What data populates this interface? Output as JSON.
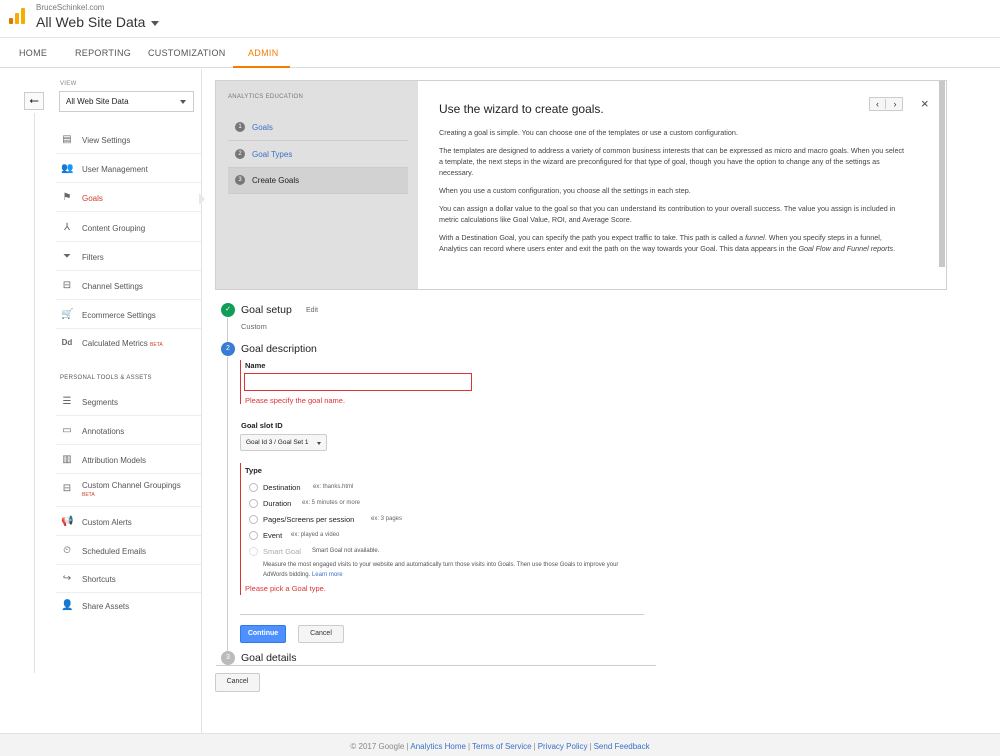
{
  "header": {
    "account": "BruceSchinkel.com",
    "property": "All Web Site Data"
  },
  "nav": {
    "tabs": [
      {
        "label": "HOME",
        "active": false
      },
      {
        "label": "REPORTING",
        "active": false
      },
      {
        "label": "CUSTOMIZATION",
        "active": false
      },
      {
        "label": "ADMIN",
        "active": true
      }
    ],
    "accent_color": "#f57c00"
  },
  "sidebar": {
    "back_icon": "arrow-left-icon",
    "back_glyph": "⭠",
    "view_label": "VIEW",
    "view_value": "All Web Site Data",
    "items": [
      {
        "label": "View Settings",
        "icon": "document-icon",
        "glyph": "▤",
        "active": false
      },
      {
        "label": "User Management",
        "icon": "users-icon",
        "glyph": "👥",
        "active": false
      },
      {
        "label": "Goals",
        "icon": "flag-icon",
        "glyph": "⚑",
        "active": true
      },
      {
        "label": "Content Grouping",
        "icon": "person-walk-icon",
        "glyph": "⅄",
        "active": false
      },
      {
        "label": "Filters",
        "icon": "funnel-icon",
        "glyph": "⏷",
        "active": false
      },
      {
        "label": "Channel Settings",
        "icon": "channel-icon",
        "glyph": "⊟",
        "active": false
      },
      {
        "label": "Ecommerce Settings",
        "icon": "cart-icon",
        "glyph": "🛒",
        "active": false
      },
      {
        "label": "Calculated Metrics",
        "icon": "dd-icon",
        "glyph": "Dd",
        "active": false,
        "badge": "BETA"
      }
    ],
    "section_heading": "PERSONAL TOOLS & ASSETS",
    "personal_items": [
      {
        "label": "Segments",
        "icon": "segments-icon",
        "glyph": "☰"
      },
      {
        "label": "Annotations",
        "icon": "comment-icon",
        "glyph": "▭"
      },
      {
        "label": "Attribution Models",
        "icon": "bars-icon",
        "glyph": "▥"
      },
      {
        "label": "Custom Channel Groupings",
        "icon": "channel-group-icon",
        "glyph": "⊟",
        "badge": "BETA"
      },
      {
        "label": "Custom Alerts",
        "icon": "megaphone-icon",
        "glyph": "📢"
      },
      {
        "label": "Scheduled Emails",
        "icon": "clock-icon",
        "glyph": "⏲"
      },
      {
        "label": "Shortcuts",
        "icon": "shortcut-icon",
        "glyph": "↪"
      },
      {
        "label": "Share Assets",
        "icon": "add-user-icon",
        "glyph": "👤"
      }
    ]
  },
  "education": {
    "heading": "ANALYTICS EDUCATION",
    "steps": [
      {
        "num": "1",
        "label": "Goals",
        "current": false
      },
      {
        "num": "2",
        "label": "Goal Types",
        "current": false
      },
      {
        "num": "3",
        "label": "Create Goals",
        "current": true
      }
    ],
    "title": "Use the wizard to create goals.",
    "prev_glyph": "‹",
    "next_glyph": "›",
    "close_glyph": "×",
    "p1": "Creating a goal is simple. You can choose one of the templates or use a custom configuration.",
    "p2": "The templates are designed to address a variety of common business interests that can be expressed as micro and macro goals. When you select a template, the next steps in the wizard are preconfigured for that type of goal, though you have the option to change any of the settings as necessary.",
    "p3": "When you use a custom configuration, you choose all the settings in each step.",
    "p4": "You can assign a dollar value to the goal so that you can understand its contribution to your overall success. The value you assign is included in metric calculations like Goal Value, ROI, and Average Score.",
    "p5a": "With a Destination Goal, you can specify the path you expect traffic to take. This path is called a ",
    "p5b": "funnel",
    "p5c": ". When you specify steps in a funnel, Analytics can record where users enter and exit the path on the way towards your Goal. This data appears in the ",
    "p5d": "Goal Flow and Funnel reports",
    "p5e": "."
  },
  "goal_setup": {
    "check_glyph": "✓",
    "title": "Goal setup",
    "edit": "Edit",
    "value": "Custom"
  },
  "goal_description": {
    "num": "2",
    "title": "Goal description",
    "name_label": "Name",
    "name_value": "",
    "name_error": "Please specify the goal name.",
    "slot_label": "Goal slot ID",
    "slot_value": "Goal Id 3 / Goal Set 1",
    "type_label": "Type",
    "types": [
      {
        "label": "Destination",
        "example": "ex: thanks.html"
      },
      {
        "label": "Duration",
        "example": "ex: 5 minutes or more"
      },
      {
        "label": "Pages/Screens per session",
        "example": "ex: 3 pages"
      },
      {
        "label": "Event",
        "example": "ex: played a video"
      }
    ],
    "smart_goal_label": "Smart Goal",
    "smart_goal_note": "Smart Goal not available.",
    "smart_goal_desc": "Measure the most engaged visits to your website and automatically turn those visits into Goals. Then use those Goals to improve your AdWords bidding.",
    "learn_more": "Learn more",
    "type_error": "Please pick a Goal type.",
    "continue": "Continue",
    "cancel": "Cancel"
  },
  "goal_details": {
    "num": "3",
    "title": "Goal details"
  },
  "bottom_cancel": "Cancel",
  "footer": {
    "copyright": "© 2017 Google",
    "links": [
      "Analytics Home",
      "Terms of Service",
      "Privacy Policy",
      "Send Feedback"
    ]
  }
}
